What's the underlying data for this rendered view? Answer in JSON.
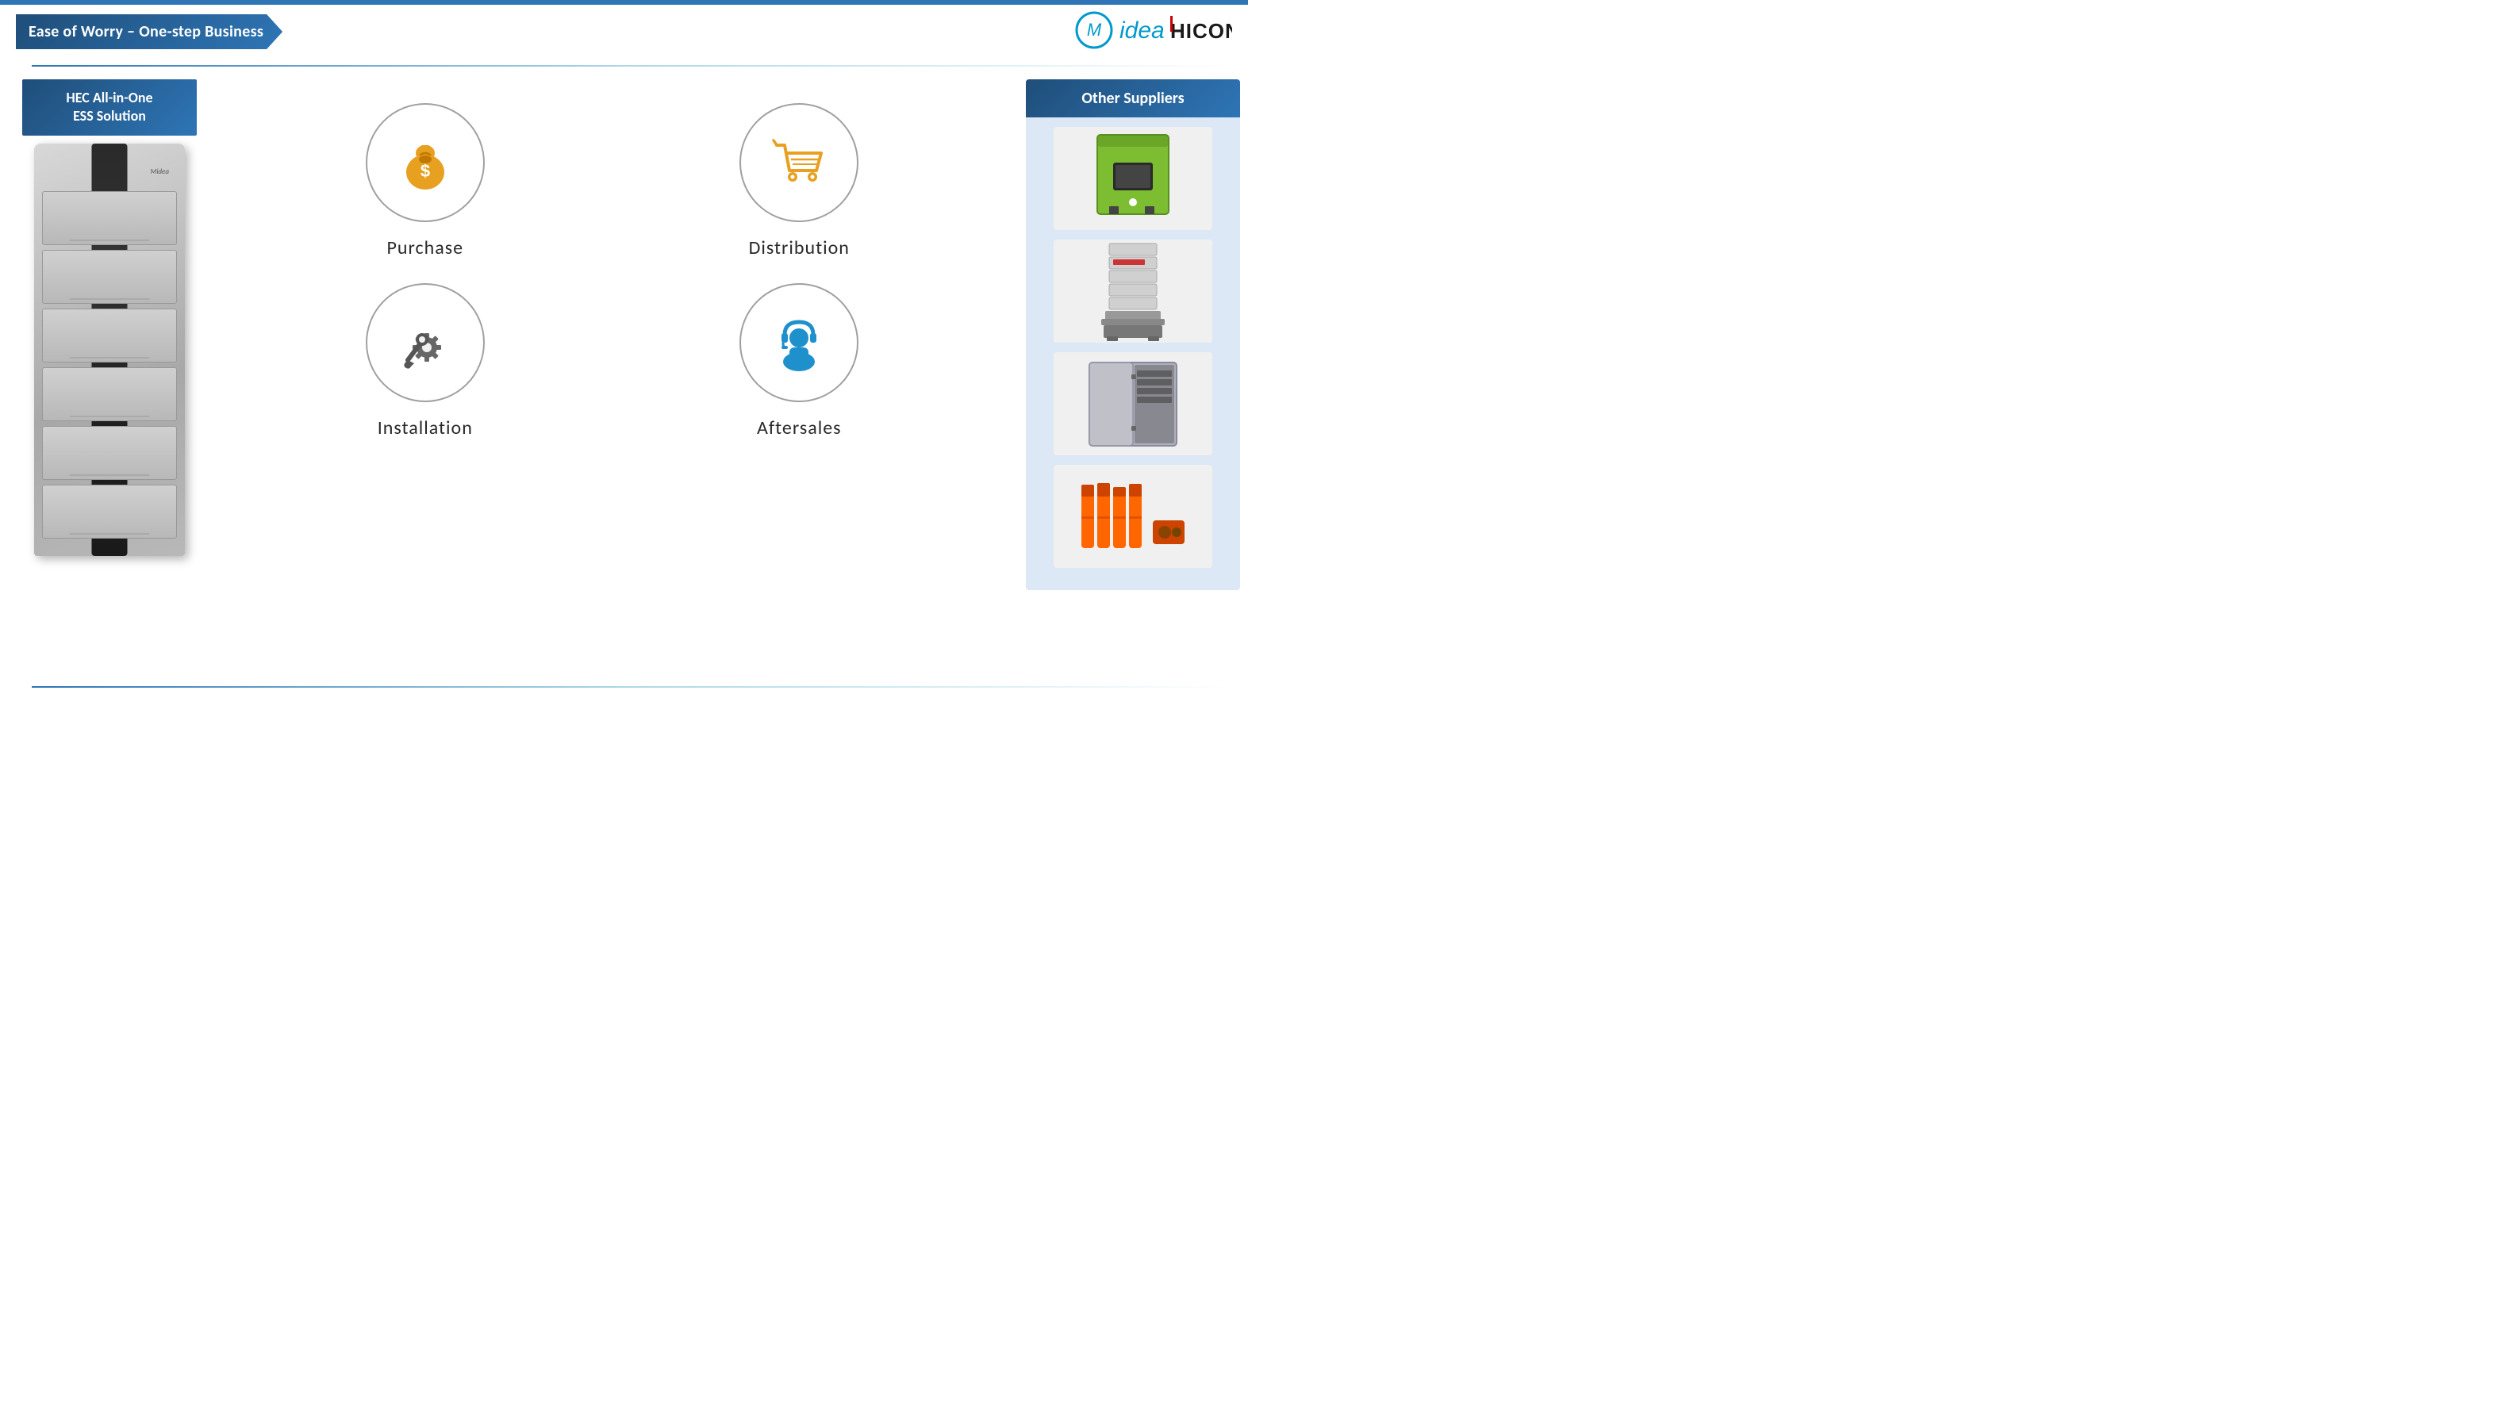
{
  "header": {
    "title": "Ease of Worry – One-step Business"
  },
  "logo": {
    "midea": "Midea",
    "hiconics": "HICONICS"
  },
  "left_panel": {
    "line1": "HEC All-in-One",
    "line2": "ESS Solution"
  },
  "services": [
    {
      "id": "purchase",
      "label": "Purchase",
      "icon_type": "money-bag",
      "color": "#e8a020"
    },
    {
      "id": "distribution",
      "label": "Distribution",
      "icon_type": "shopping-cart",
      "color": "#e8a020"
    },
    {
      "id": "installation",
      "label": "Installation",
      "icon_type": "wrench-gear",
      "color": "#555555"
    },
    {
      "id": "aftersales",
      "label": "Aftersales",
      "icon_type": "headset-person",
      "color": "#1e90cc"
    }
  ],
  "right_panel": {
    "title": "Other Suppliers",
    "products": [
      "Green inverter device",
      "White battery stack",
      "Grey electrical box",
      "Orange cable set"
    ]
  }
}
